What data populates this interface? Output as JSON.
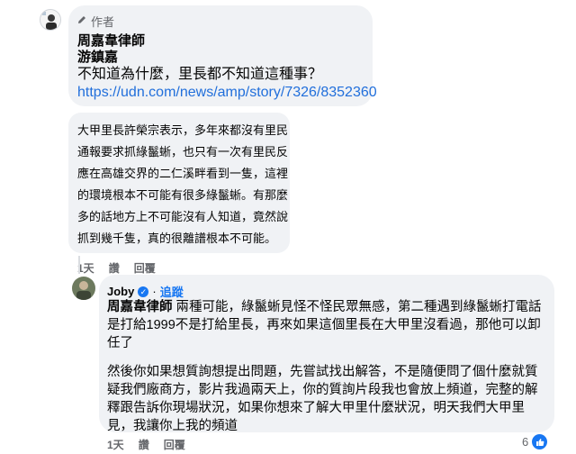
{
  "comment1": {
    "author_badge": "作者",
    "tag_name": "周嘉韋律師",
    "name": "游鎮嘉",
    "text": "不知道為什麼，里長都不知道這種事？",
    "link": "https://udn.com/news/amp/story/7326/8352360"
  },
  "quote": {
    "lines": [
      "大甲里長許榮宗表示，多年來都沒有里民",
      "通報要求抓綠鬣蜥，也只有一次有里民反",
      "應在高雄交界的二仁溪畔看到一隻，這裡",
      "的環境根本不可能有很多綠鬣蜥。有那麼",
      "多的話地方上不可能沒有人知道，竟然說",
      "抓到幾千隻，真的很離譜根本不可能。"
    ]
  },
  "comment1_meta": {
    "time": "1天",
    "like": "讚",
    "reply": "回覆"
  },
  "reply": {
    "author": "Joby",
    "follow": "追蹤",
    "tag": "周嘉韋律師",
    "para1": [
      " 兩種可能，綠鬣蜥見怪不怪民眾無感，第二種遇到綠鬣蜥打電話",
      "是打給1999不是打給里長，再來如果這個里長在大甲里沒看過，那他可以卸",
      "任了"
    ],
    "para2": [
      "然後你如果想質詢想提出問題，先嘗試找出解答，不是隨便問了個什麼就質",
      "疑我們廠商方，影片我過兩天上，你的質詢片段我也會放上頻道，完整的解",
      "釋跟告訴你現場狀況，如果你想來了解大甲里什麼狀況，明天我們大甲里",
      "見，我讓你上我的頻道"
    ]
  },
  "reply_meta": {
    "time": "1天",
    "like": "讚",
    "reply": "回覆",
    "reaction_count": "6"
  },
  "colors": {
    "accent": "#1877f2",
    "bubble": "#f0f2f5",
    "link": "#216fdb"
  },
  "icons": [
    "pen-icon",
    "verified-icon",
    "like-icon"
  ]
}
